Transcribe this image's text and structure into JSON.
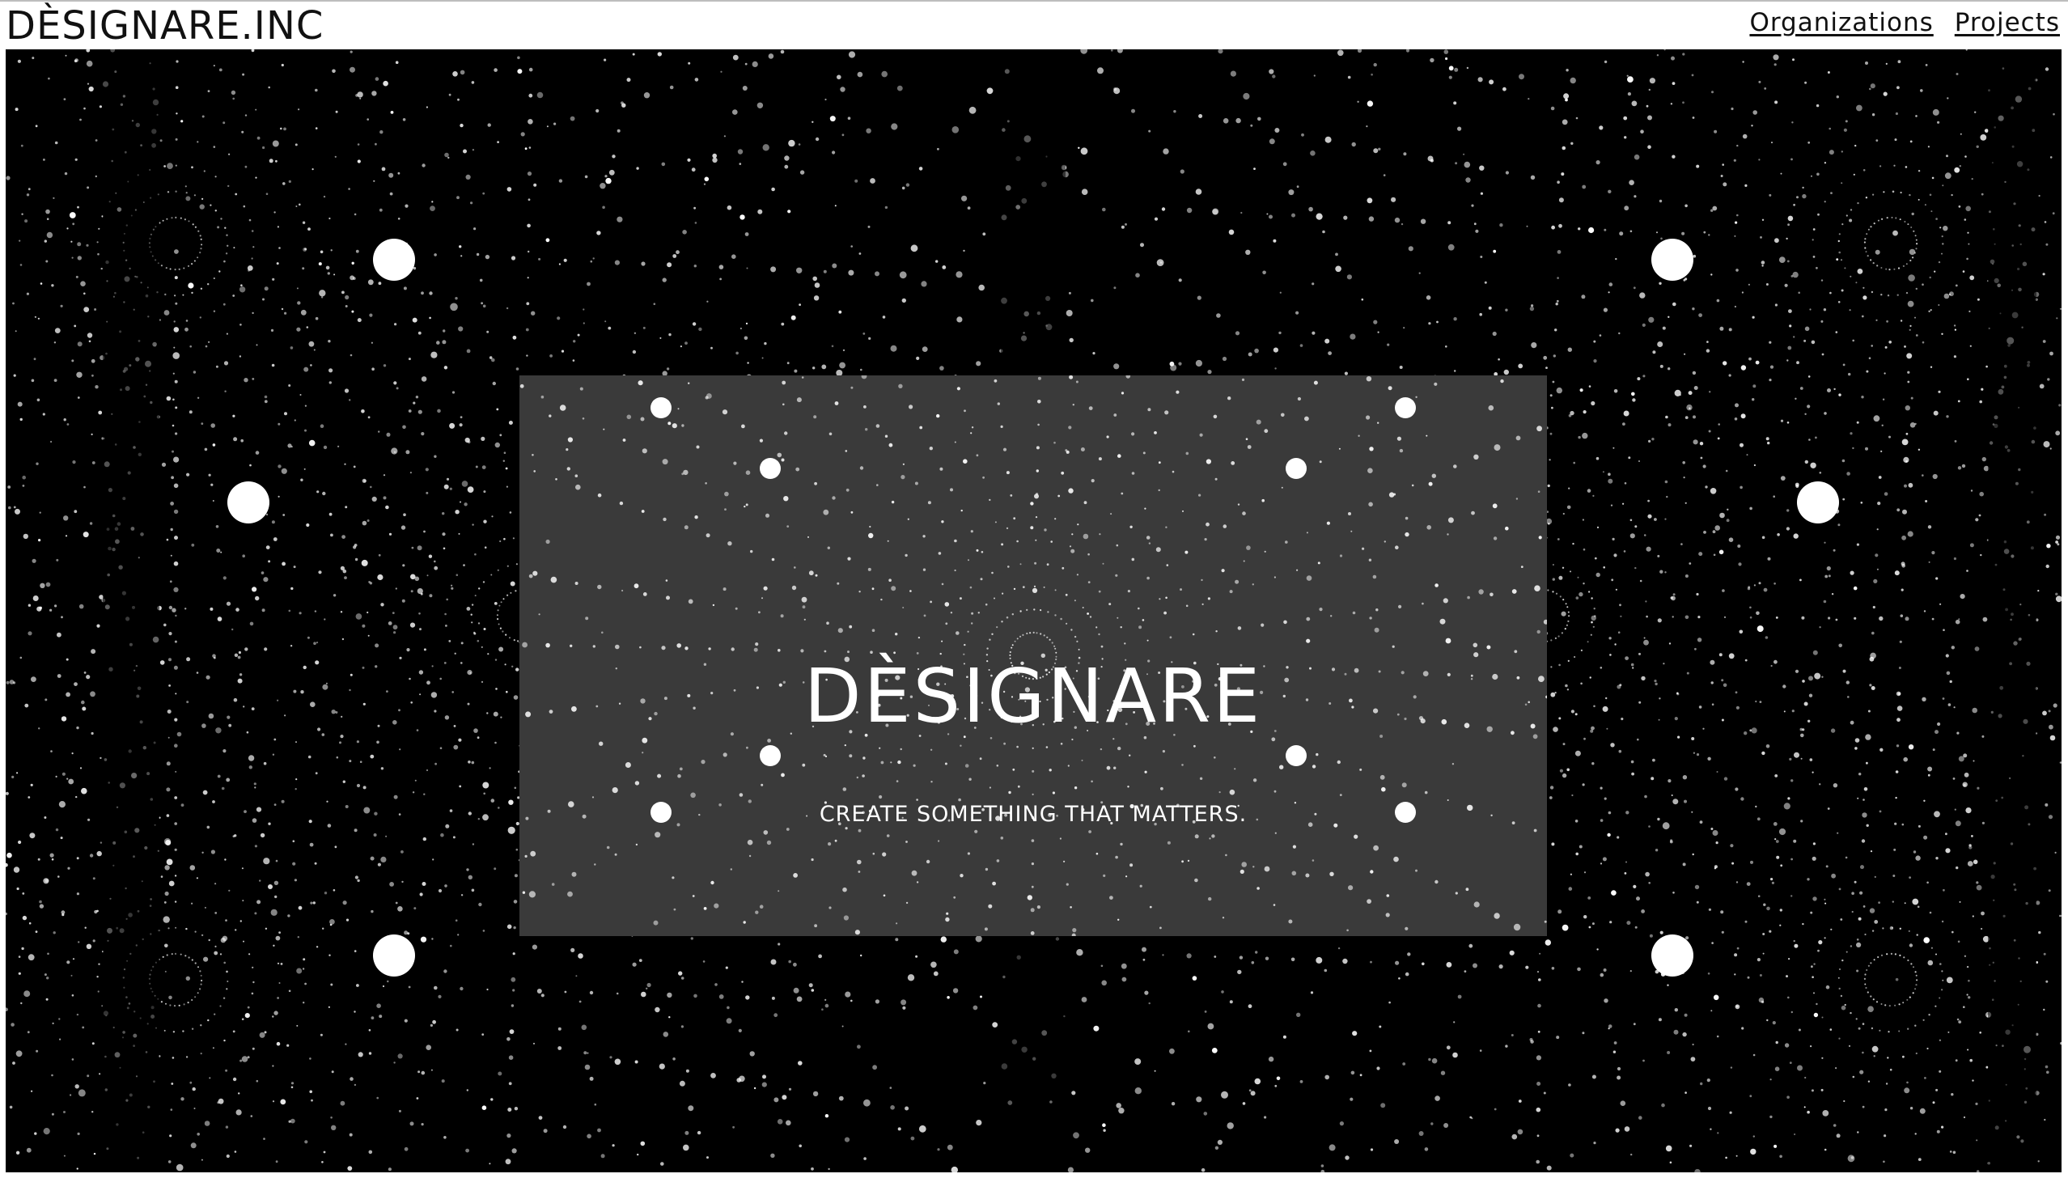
{
  "header": {
    "logo": "DÈSIGNARE.INC",
    "nav": [
      {
        "label": "Organizations"
      },
      {
        "label": "Projects"
      }
    ]
  },
  "hero": {
    "title": "DÈSIGNARE",
    "subtitle": "CREATE SOMETHING THAT MATTERS.",
    "background_image": "black starfield kaleidoscope pattern with radiating dotted lines",
    "colors": {
      "background": "#000000",
      "panel": "#4a4a4a",
      "text": "#ffffff"
    }
  }
}
